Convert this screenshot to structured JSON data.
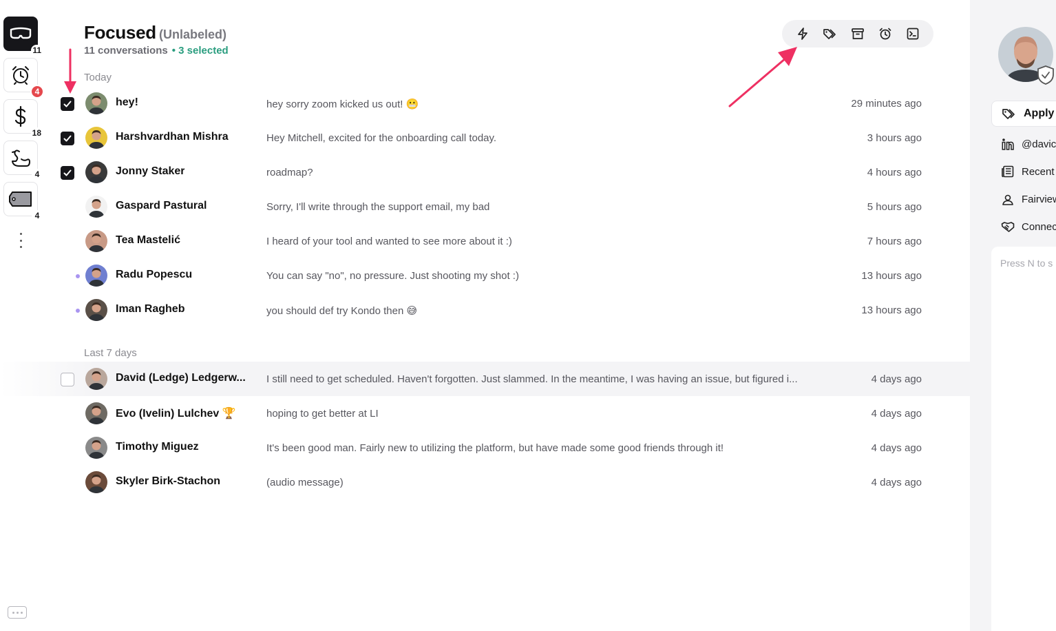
{
  "rail": {
    "items": [
      {
        "icon": "goggles-icon",
        "count": "11"
      },
      {
        "icon": "alarm-clock-icon",
        "count": "4",
        "count_style": "red"
      },
      {
        "icon": "dollar-icon",
        "count": "18"
      },
      {
        "icon": "swan-icon",
        "count": "4"
      },
      {
        "icon": "tag-label-icon",
        "count": "4"
      }
    ]
  },
  "header": {
    "title": "Focused",
    "subtitle": "(Unlabeled)",
    "conversations": "11 conversations",
    "selected": "• 3 selected"
  },
  "toolbar": {
    "actions": [
      "lightning-icon",
      "labels-icon",
      "archive-icon",
      "snooze-icon",
      "terminal-icon"
    ]
  },
  "sections": [
    {
      "label": "Today",
      "rows": [
        {
          "checked": true,
          "unread": false,
          "name": "hey!",
          "preview": "hey sorry zoom kicked us out! 😬",
          "time": "29 minutes ago",
          "avatar_color": "#7c8c6e"
        },
        {
          "checked": true,
          "unread": false,
          "name": "Harshvardhan Mishra",
          "preview": "Hey Mitchell, excited for the onboarding call today.",
          "time": "3 hours ago",
          "avatar_color": "#e8c53a"
        },
        {
          "checked": true,
          "unread": false,
          "name": "Jonny Staker",
          "preview": "roadmap?",
          "time": "4 hours ago",
          "avatar_color": "#3a3a3a"
        },
        {
          "checked": false,
          "unread": false,
          "name": "Gaspard Pastural",
          "preview": "Sorry, I'll write through the support email, my bad",
          "time": "5 hours ago",
          "avatar_color": "#f2f2f2"
        },
        {
          "checked": false,
          "unread": false,
          "name": "Tea Mastelić",
          "preview": "I heard of your tool and wanted to see more about it :)",
          "time": "7 hours ago",
          "avatar_color": "#c89a86"
        },
        {
          "checked": false,
          "unread": true,
          "name": "Radu Popescu",
          "preview": "You can say \"no\", no pressure. Just shooting my shot :)",
          "time": "13 hours ago",
          "avatar_color": "#6f7fd0"
        },
        {
          "checked": false,
          "unread": true,
          "name": "Iman Ragheb",
          "preview": "you should def try Kondo then 😅",
          "time": "13 hours ago",
          "avatar_color": "#5a5048"
        }
      ]
    },
    {
      "label": "Last 7 days",
      "rows": [
        {
          "checked": false,
          "unread": false,
          "hover": true,
          "name": "David (Ledge) Ledgerw...",
          "preview": "I still need to get scheduled. Haven't forgotten. Just slammed. In the meantime, I was having an issue, but figured i...",
          "time": "4 days ago",
          "avatar_color": "#b9a79c"
        },
        {
          "checked": false,
          "unread": false,
          "name": "Evo (Ivelin) Lulchev 🏆",
          "preview": "hoping to get better at LI",
          "time": "4 days ago",
          "avatar_color": "#6e6a63"
        },
        {
          "checked": false,
          "unread": false,
          "name": "Timothy Miguez",
          "preview": "It's been good man. Fairly new to utilizing the platform, but have made some good friends through it!",
          "time": "4 days ago",
          "avatar_color": "#8a8a8a"
        },
        {
          "checked": false,
          "unread": false,
          "name": "Skyler Birk-Stachon",
          "preview": "(audio message)",
          "time": "4 days ago",
          "avatar_color": "#6b4b3a"
        }
      ]
    }
  ],
  "right_panel": {
    "apply_label": "Apply l",
    "items": [
      {
        "icon": "linkedin-icon",
        "label": "@davic"
      },
      {
        "icon": "news-icon",
        "label": "Recent"
      },
      {
        "icon": "location-icon",
        "label": "Fairview"
      },
      {
        "icon": "handshake-icon",
        "label": "Connec"
      }
    ],
    "notes_placeholder": "Press N to s"
  },
  "colors": {
    "accent_selected": "#2a9d7f",
    "annotation_arrow": "#ee3062",
    "badge_red": "#e5484d",
    "unread_dot": "#a995f0"
  }
}
